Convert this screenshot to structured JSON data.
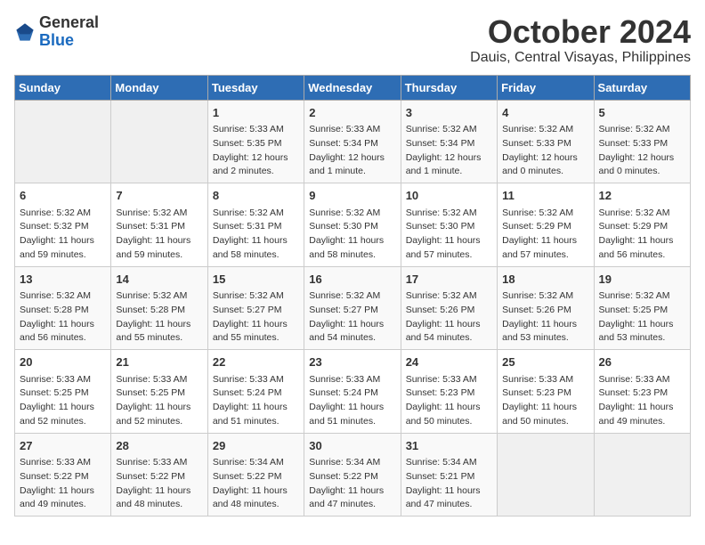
{
  "header": {
    "logo_general": "General",
    "logo_blue": "Blue",
    "month_year": "October 2024",
    "location": "Dauis, Central Visayas, Philippines"
  },
  "columns": [
    "Sunday",
    "Monday",
    "Tuesday",
    "Wednesday",
    "Thursday",
    "Friday",
    "Saturday"
  ],
  "weeks": [
    [
      {
        "day": "",
        "info": ""
      },
      {
        "day": "",
        "info": ""
      },
      {
        "day": "1",
        "info": "Sunrise: 5:33 AM\nSunset: 5:35 PM\nDaylight: 12 hours\nand 2 minutes."
      },
      {
        "day": "2",
        "info": "Sunrise: 5:33 AM\nSunset: 5:34 PM\nDaylight: 12 hours\nand 1 minute."
      },
      {
        "day": "3",
        "info": "Sunrise: 5:32 AM\nSunset: 5:34 PM\nDaylight: 12 hours\nand 1 minute."
      },
      {
        "day": "4",
        "info": "Sunrise: 5:32 AM\nSunset: 5:33 PM\nDaylight: 12 hours\nand 0 minutes."
      },
      {
        "day": "5",
        "info": "Sunrise: 5:32 AM\nSunset: 5:33 PM\nDaylight: 12 hours\nand 0 minutes."
      }
    ],
    [
      {
        "day": "6",
        "info": "Sunrise: 5:32 AM\nSunset: 5:32 PM\nDaylight: 11 hours\nand 59 minutes."
      },
      {
        "day": "7",
        "info": "Sunrise: 5:32 AM\nSunset: 5:31 PM\nDaylight: 11 hours\nand 59 minutes."
      },
      {
        "day": "8",
        "info": "Sunrise: 5:32 AM\nSunset: 5:31 PM\nDaylight: 11 hours\nand 58 minutes."
      },
      {
        "day": "9",
        "info": "Sunrise: 5:32 AM\nSunset: 5:30 PM\nDaylight: 11 hours\nand 58 minutes."
      },
      {
        "day": "10",
        "info": "Sunrise: 5:32 AM\nSunset: 5:30 PM\nDaylight: 11 hours\nand 57 minutes."
      },
      {
        "day": "11",
        "info": "Sunrise: 5:32 AM\nSunset: 5:29 PM\nDaylight: 11 hours\nand 57 minutes."
      },
      {
        "day": "12",
        "info": "Sunrise: 5:32 AM\nSunset: 5:29 PM\nDaylight: 11 hours\nand 56 minutes."
      }
    ],
    [
      {
        "day": "13",
        "info": "Sunrise: 5:32 AM\nSunset: 5:28 PM\nDaylight: 11 hours\nand 56 minutes."
      },
      {
        "day": "14",
        "info": "Sunrise: 5:32 AM\nSunset: 5:28 PM\nDaylight: 11 hours\nand 55 minutes."
      },
      {
        "day": "15",
        "info": "Sunrise: 5:32 AM\nSunset: 5:27 PM\nDaylight: 11 hours\nand 55 minutes."
      },
      {
        "day": "16",
        "info": "Sunrise: 5:32 AM\nSunset: 5:27 PM\nDaylight: 11 hours\nand 54 minutes."
      },
      {
        "day": "17",
        "info": "Sunrise: 5:32 AM\nSunset: 5:26 PM\nDaylight: 11 hours\nand 54 minutes."
      },
      {
        "day": "18",
        "info": "Sunrise: 5:32 AM\nSunset: 5:26 PM\nDaylight: 11 hours\nand 53 minutes."
      },
      {
        "day": "19",
        "info": "Sunrise: 5:32 AM\nSunset: 5:25 PM\nDaylight: 11 hours\nand 53 minutes."
      }
    ],
    [
      {
        "day": "20",
        "info": "Sunrise: 5:33 AM\nSunset: 5:25 PM\nDaylight: 11 hours\nand 52 minutes."
      },
      {
        "day": "21",
        "info": "Sunrise: 5:33 AM\nSunset: 5:25 PM\nDaylight: 11 hours\nand 52 minutes."
      },
      {
        "day": "22",
        "info": "Sunrise: 5:33 AM\nSunset: 5:24 PM\nDaylight: 11 hours\nand 51 minutes."
      },
      {
        "day": "23",
        "info": "Sunrise: 5:33 AM\nSunset: 5:24 PM\nDaylight: 11 hours\nand 51 minutes."
      },
      {
        "day": "24",
        "info": "Sunrise: 5:33 AM\nSunset: 5:23 PM\nDaylight: 11 hours\nand 50 minutes."
      },
      {
        "day": "25",
        "info": "Sunrise: 5:33 AM\nSunset: 5:23 PM\nDaylight: 11 hours\nand 50 minutes."
      },
      {
        "day": "26",
        "info": "Sunrise: 5:33 AM\nSunset: 5:23 PM\nDaylight: 11 hours\nand 49 minutes."
      }
    ],
    [
      {
        "day": "27",
        "info": "Sunrise: 5:33 AM\nSunset: 5:22 PM\nDaylight: 11 hours\nand 49 minutes."
      },
      {
        "day": "28",
        "info": "Sunrise: 5:33 AM\nSunset: 5:22 PM\nDaylight: 11 hours\nand 48 minutes."
      },
      {
        "day": "29",
        "info": "Sunrise: 5:34 AM\nSunset: 5:22 PM\nDaylight: 11 hours\nand 48 minutes."
      },
      {
        "day": "30",
        "info": "Sunrise: 5:34 AM\nSunset: 5:22 PM\nDaylight: 11 hours\nand 47 minutes."
      },
      {
        "day": "31",
        "info": "Sunrise: 5:34 AM\nSunset: 5:21 PM\nDaylight: 11 hours\nand 47 minutes."
      },
      {
        "day": "",
        "info": ""
      },
      {
        "day": "",
        "info": ""
      }
    ]
  ]
}
